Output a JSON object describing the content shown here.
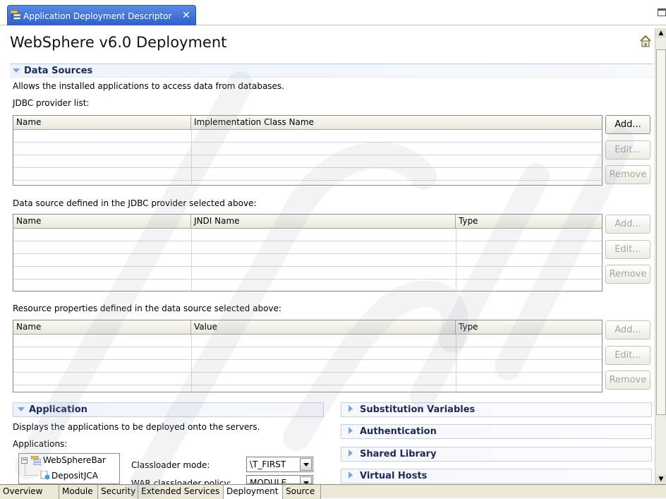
{
  "editor_tab": {
    "title": "Application Deployment Descriptor",
    "close": "✕"
  },
  "page_title": "WebSphere v6.0 Deployment",
  "data_sources": {
    "title": "Data Sources",
    "description": "Allows the installed applications to access data from databases.",
    "jdbc": {
      "label": "JDBC provider list:",
      "columns": [
        "Name",
        "Implementation Class Name"
      ],
      "buttons": {
        "add": "Add...",
        "edit": "Edit...",
        "remove": "Remove"
      }
    },
    "datasource": {
      "label": "Data source defined in the JDBC provider selected above:",
      "columns": [
        "Name",
        "JNDI Name",
        "Type"
      ],
      "buttons": {
        "add": "Add...",
        "edit": "Edit...",
        "remove": "Remove"
      }
    },
    "resource": {
      "label": "Resource properties defined in the data source selected above:",
      "columns": [
        "Name",
        "Value",
        "Type"
      ],
      "buttons": {
        "add": "Add...",
        "edit": "Edit...",
        "remove": "Remove"
      }
    }
  },
  "application": {
    "title": "Application",
    "description": "Displays the applications to be deployed onto the servers.",
    "apps_label": "Applications:",
    "tree": [
      "WebSphereBar",
      "DepositJCA"
    ],
    "classloader_label": "Classloader mode:",
    "classloader_value": "\\T_FIRST",
    "war_label": "WAR classloader policy:",
    "war_value": "MODULE"
  },
  "right_sections": [
    "Substitution Variables",
    "Authentication",
    "Shared Library",
    "Virtual Hosts"
  ],
  "bottom_tabs": [
    "Overview",
    "Module",
    "Security",
    "Extended Services",
    "Deployment",
    "Source"
  ],
  "active_bottom_tab": "Deployment",
  "colors": {
    "tab_blue": "#3d6fd6",
    "section_text": "#1e2a55",
    "twisty": "#7fa3d8"
  },
  "icons": {
    "tab": "descriptor-icon",
    "home": "home-icon",
    "expand": "expand-icon"
  }
}
